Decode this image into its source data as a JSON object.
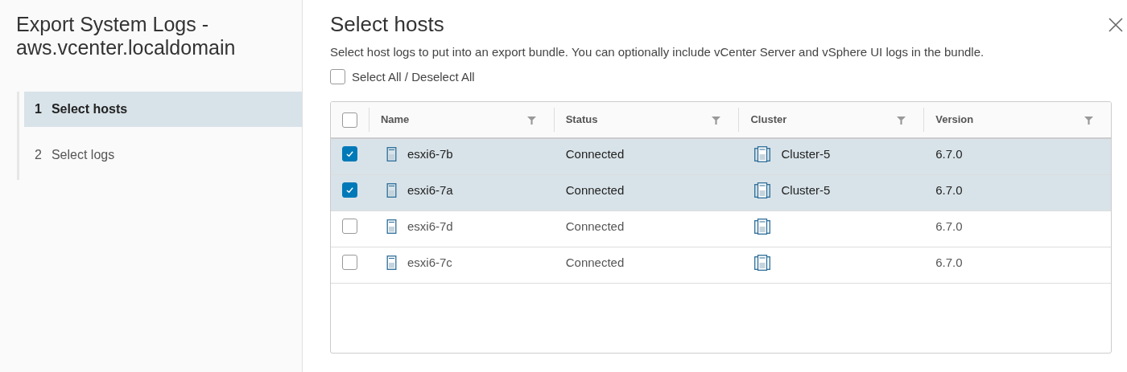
{
  "dialog": {
    "title": "Export System Logs - aws.vcenter.localdomain"
  },
  "steps": [
    {
      "number": "1",
      "label": "Select hosts",
      "selected": true
    },
    {
      "number": "2",
      "label": "Select logs",
      "selected": false
    }
  ],
  "page": {
    "title": "Select hosts",
    "description": "Select host logs to put into an export bundle. You can optionally include vCenter Server and vSphere UI logs in the bundle.",
    "select_all": {
      "label": "Select All / Deselect All",
      "checked": false
    }
  },
  "table": {
    "header_checked": false,
    "columns": [
      "Name",
      "Status",
      "Cluster",
      "Version"
    ],
    "rows": [
      {
        "name": "esxi6-7b",
        "status": "Connected",
        "cluster": "Cluster-5",
        "version": "6.7.0",
        "selected": true
      },
      {
        "name": "esxi6-7a",
        "status": "Connected",
        "cluster": "Cluster-5",
        "version": "6.7.0",
        "selected": true
      },
      {
        "name": "esxi6-7d",
        "status": "Connected",
        "version": "6.7.0",
        "selected": false
      },
      {
        "name": "esxi6-7c",
        "status": "Connected",
        "version": "6.7.0",
        "selected": false
      }
    ]
  }
}
